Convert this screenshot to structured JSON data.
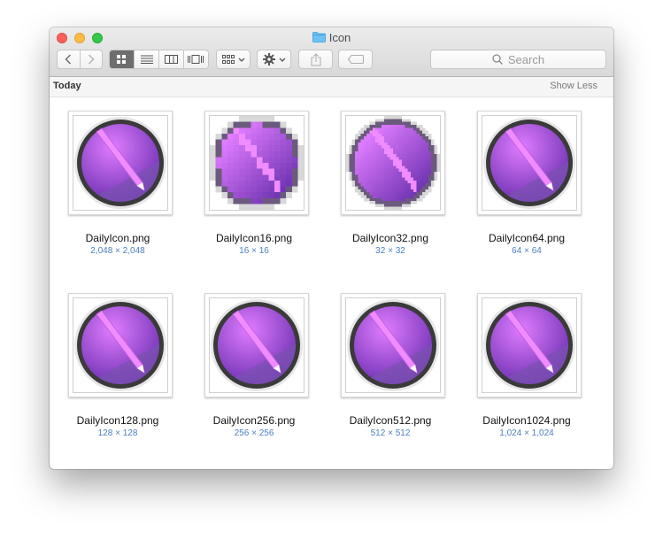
{
  "window": {
    "title": "Icon",
    "folder_color": "#6cc1f5"
  },
  "toolbar": {
    "back_icon": "chevron-left-icon",
    "forward_icon": "chevron-right-icon",
    "view_modes": [
      "icon-view-icon",
      "list-view-icon",
      "column-view-icon",
      "cover-flow-icon"
    ],
    "active_view": "icon-view-icon",
    "arrange_icon": "arrange-grid-icon",
    "action_icon": "gear-icon",
    "share_icon": "share-icon",
    "tag_icon": "tag-icon",
    "search_placeholder": "Search"
  },
  "section": {
    "title": "Today",
    "toggle_label": "Show Less"
  },
  "colors": {
    "dimension_text": "#4a7fc1",
    "icon_purple_light": "#e07cff",
    "icon_purple_dark": "#6a2fb0",
    "icon_ring": "#3a3a3a"
  },
  "files": [
    {
      "name": "DailyIcon.png",
      "dims": "2,048 × 2,048",
      "pixelated": 0
    },
    {
      "name": "DailyIcon16.png",
      "dims": "16 × 16",
      "pixelated": 16
    },
    {
      "name": "DailyIcon32.png",
      "dims": "32 × 32",
      "pixelated": 32
    },
    {
      "name": "DailyIcon64.png",
      "dims": "64 × 64",
      "pixelated": 0
    },
    {
      "name": "DailyIcon128.png",
      "dims": "128 × 128",
      "pixelated": 0
    },
    {
      "name": "DailyIcon256.png",
      "dims": "256 × 256",
      "pixelated": 0
    },
    {
      "name": "DailyIcon512.png",
      "dims": "512 × 512",
      "pixelated": 0
    },
    {
      "name": "DailyIcon1024.png",
      "dims": "1,024 × 1,024",
      "pixelated": 0
    }
  ]
}
